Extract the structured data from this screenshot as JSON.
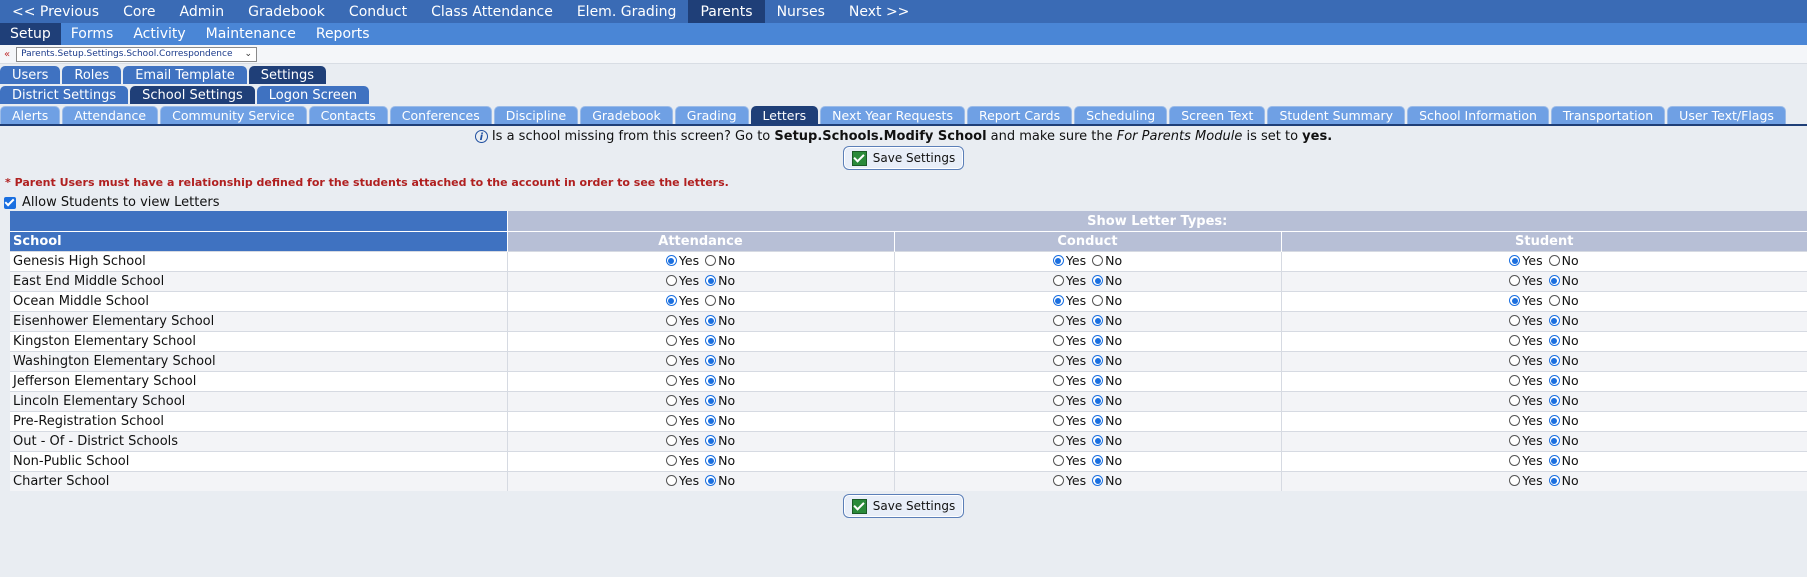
{
  "topnav": [
    "<< Previous",
    "Core",
    "Admin",
    "Gradebook",
    "Conduct",
    "Class Attendance",
    "Elem. Grading",
    "Parents",
    "Nurses",
    "Next >>"
  ],
  "topnav_active": "Parents",
  "subnav": [
    "Setup",
    "Forms",
    "Activity",
    "Maintenance",
    "Reports"
  ],
  "subnav_active": "Setup",
  "breadcrumb": {
    "back": "«",
    "path": "Parents.Setup.Settings.School.Correspondence"
  },
  "tabs1": [
    "Users",
    "Roles",
    "Email Template",
    "Settings"
  ],
  "tabs1_active": "Settings",
  "tabs2": [
    "District Settings",
    "School Settings",
    "Logon Screen"
  ],
  "tabs2_active": "School Settings",
  "tabs3": [
    "Alerts",
    "Attendance",
    "Community Service",
    "Contacts",
    "Conferences",
    "Discipline",
    "Gradebook",
    "Grading",
    "Letters",
    "Next Year Requests",
    "Report Cards",
    "Scheduling",
    "Screen Text",
    "Student Summary",
    "School Information",
    "Transportation",
    "User Text/Flags"
  ],
  "tabs3_active": "Letters",
  "info": {
    "pre": "Is a school missing from this screen? Go to ",
    "bold1": "Setup.Schools.Modify School",
    "mid": " and make sure the ",
    "ital": "For Parents Module",
    "mid2": " is set to ",
    "bold2": "yes."
  },
  "save_label": "Save Settings",
  "note": "* Parent Users must have a relationship defined for the students attached to the account in order to see the letters.",
  "allow_label": "Allow Students to view Letters",
  "allow_checked": true,
  "table": {
    "group_header": "Show Letter Types:",
    "school_header": "School",
    "columns": [
      "Attendance",
      "Conduct",
      "Student"
    ],
    "yes": "Yes",
    "no": "No",
    "rows": [
      {
        "school": "Genesis High School",
        "values": [
          "Yes",
          "Yes",
          "Yes"
        ]
      },
      {
        "school": "East End Middle School",
        "values": [
          "No",
          "No",
          "No"
        ]
      },
      {
        "school": "Ocean Middle School",
        "values": [
          "Yes",
          "Yes",
          "Yes"
        ]
      },
      {
        "school": "Eisenhower Elementary School",
        "values": [
          "No",
          "No",
          "No"
        ]
      },
      {
        "school": "Kingston Elementary School",
        "values": [
          "No",
          "No",
          "No"
        ]
      },
      {
        "school": "Washington Elementary School",
        "values": [
          "No",
          "No",
          "No"
        ]
      },
      {
        "school": "Jefferson Elementary School",
        "values": [
          "No",
          "No",
          "No"
        ]
      },
      {
        "school": "Lincoln Elementary School",
        "values": [
          "No",
          "No",
          "No"
        ]
      },
      {
        "school": "Pre-Registration School",
        "values": [
          "No",
          "No",
          "No"
        ]
      },
      {
        "school": "Out - Of - District Schools",
        "values": [
          "No",
          "No",
          "No"
        ]
      },
      {
        "school": "Non-Public School",
        "values": [
          "No",
          "No",
          "No"
        ]
      },
      {
        "school": "Charter School",
        "values": [
          "No",
          "No",
          "No"
        ]
      }
    ]
  }
}
